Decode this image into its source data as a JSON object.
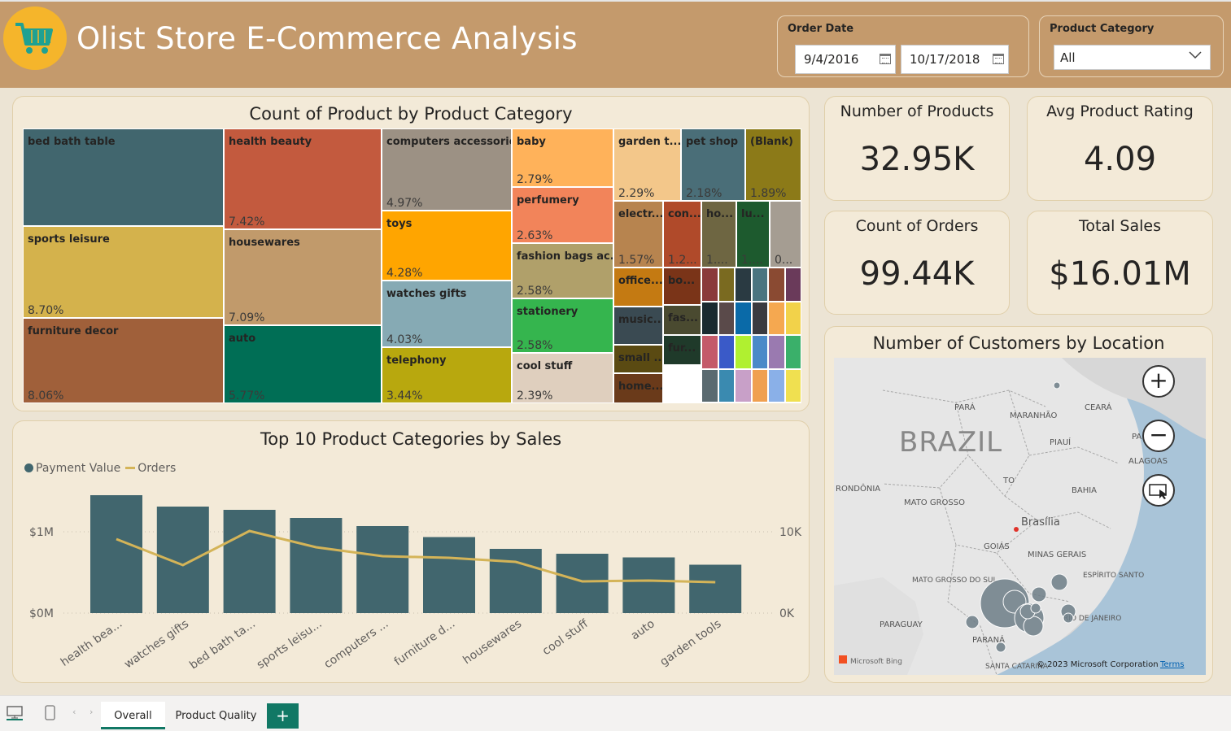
{
  "header": {
    "title": "Olist Store E-Commerce Analysis",
    "logo_icon": "shopping-cart-icon"
  },
  "filters": {
    "order_date_label": "Order Date",
    "date_from": "9/4/2016",
    "date_to": "10/17/2018",
    "product_category_label": "Product Category",
    "product_category_value": "All"
  },
  "kpis": [
    {
      "title": "Number of Products",
      "value": "32.95K"
    },
    {
      "title": "Avg Product Rating",
      "value": "4.09"
    },
    {
      "title": "Count of Orders",
      "value": "99.44K"
    },
    {
      "title": "Total Sales",
      "value": "$16.01M"
    }
  ],
  "treemap": {
    "title": "Count of Product by Product Category",
    "tiles": [
      {
        "label": "bed bath table",
        "pct": "",
        "color": "#41666e"
      },
      {
        "label": "sports leisure",
        "pct": "8.70%",
        "color": "#d4b24c"
      },
      {
        "label": "furniture decor",
        "pct": "8.06%",
        "color": "#a0603a"
      },
      {
        "label": "health beauty",
        "pct": "7.42%",
        "color": "#c35a3e"
      },
      {
        "label": "housewares",
        "pct": "7.09%",
        "color": "#c19a6b"
      },
      {
        "label": "auto",
        "pct": "5.77%",
        "color": "#006e55"
      },
      {
        "label": "computers accessories",
        "pct": "4.97%",
        "color": "#9c9184"
      },
      {
        "label": "toys",
        "pct": "4.28%",
        "color": "#ffa500"
      },
      {
        "label": "watches gifts",
        "pct": "4.03%",
        "color": "#86aab4"
      },
      {
        "label": "telephony",
        "pct": "3.44%",
        "color": "#b8a80e"
      },
      {
        "label": "baby",
        "pct": "2.79%",
        "color": "#ffb25a"
      },
      {
        "label": "perfumery",
        "pct": "2.63%",
        "color": "#f2845a"
      },
      {
        "label": "fashion bags ac...",
        "pct": "2.58%",
        "color": "#b0a06a"
      },
      {
        "label": "stationery",
        "pct": "2.58%",
        "color": "#35b54e"
      },
      {
        "label": "cool stuff",
        "pct": "2.39%",
        "color": "#dfcfbe"
      },
      {
        "label": "garden t...",
        "pct": "2.29%",
        "color": "#f3c78a"
      },
      {
        "label": "pet shop",
        "pct": "2.18%",
        "color": "#4a6e78"
      },
      {
        "label": "(Blank)",
        "pct": "1.89%",
        "color": "#8c7a18"
      },
      {
        "label": "electr...",
        "pct": "1.57%",
        "color": "#b7844f"
      },
      {
        "label": "con...",
        "pct": "1.2...",
        "color": "#b04a2a"
      },
      {
        "label": "ho...",
        "pct": "1....",
        "color": "#6e6642"
      },
      {
        "label": "lu...",
        "pct": "1....",
        "color": "#1d5a2e"
      },
      {
        "label": "",
        "pct": "0...",
        "color": "#a59d92"
      },
      {
        "label": "office...",
        "pct": "",
        "color": "#c47a12"
      },
      {
        "label": "bo...",
        "pct": "",
        "color": "#7a3418"
      },
      {
        "label": "music...",
        "pct": "",
        "color": "#3a4a52"
      },
      {
        "label": "fas...",
        "pct": "",
        "color": "#4a4a30"
      },
      {
        "label": "small ...",
        "pct": "",
        "color": "#5a4a12"
      },
      {
        "label": "fur...",
        "pct": "",
        "color": "#1f3a2a"
      },
      {
        "label": "home...",
        "pct": "",
        "color": "#6a3a1a"
      }
    ]
  },
  "bar_chart": {
    "title": "Top 10 Product Categories by Sales",
    "legend": [
      "Payment Value",
      "Orders"
    ],
    "left_ticks": [
      "$1M",
      "$0M"
    ],
    "right_ticks": [
      "10K",
      "0K"
    ]
  },
  "chart_data": {
    "type": "bar",
    "categories": [
      "health bea...",
      "watches gifts",
      "bed bath ta...",
      "sports leisu...",
      "computers ...",
      "furniture d...",
      "housewares",
      "cool stuff",
      "auto",
      "garden tools"
    ],
    "series": [
      {
        "name": "Payment Value",
        "type": "bar",
        "axis": "left",
        "values": [
          1450000,
          1310000,
          1270000,
          1170000,
          1070000,
          935000,
          790000,
          730000,
          685000,
          595000
        ]
      },
      {
        "name": "Orders",
        "type": "line",
        "axis": "right",
        "values": [
          9100,
          5900,
          10100,
          8100,
          7000,
          6800,
          6300,
          3900,
          4000,
          3800
        ]
      }
    ],
    "ylim_left": [
      0,
      1500000
    ],
    "ylim_right": [
      0,
      15000
    ],
    "xlabel": "",
    "ylabel": ""
  },
  "map": {
    "title": "Number of Customers by Location",
    "country_label": "BRAZIL",
    "place_labels": [
      "PARÁ",
      "MARANHÃO",
      "CEARÁ",
      "PIAUÍ",
      "PA",
      "ALAGOAS",
      "RONDÔNIA",
      "TO",
      "BAHIA",
      "MATO GROSSO",
      "Brasília",
      "GOIÁS",
      "MINAS GERAIS",
      "ESPÍRITO SANTO",
      "MATO GROSSO DO SUL",
      "PARAGUAY",
      "PARANÁ",
      "RIO DE JANEIRO",
      "SANTA CATARINA"
    ],
    "attribution": "© 2023 Microsoft Corporation",
    "terms": "Terms",
    "bing": "Microsoft Bing",
    "zoom_in_icon": "plus-icon",
    "zoom_out_icon": "minus-icon",
    "select_icon": "select-icon"
  },
  "tabs": {
    "items": [
      "Overall",
      "Product Quality"
    ],
    "active": "Overall",
    "add_icon": "plus-icon"
  }
}
